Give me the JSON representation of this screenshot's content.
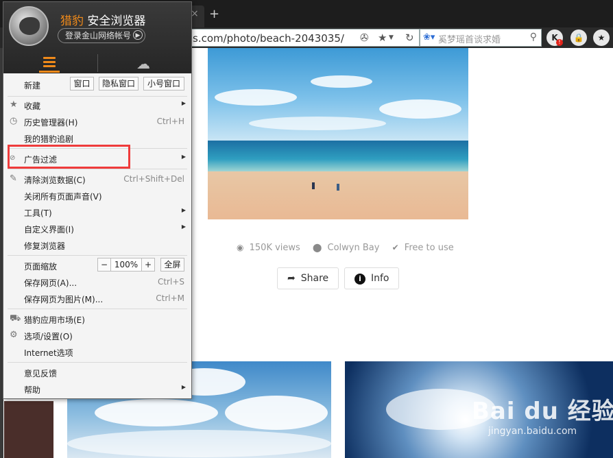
{
  "browser": {
    "tab_close": "×",
    "new_tab": "+",
    "url": "s.com/photo/beach-2043035/",
    "search_placeholder": "奚梦瑶首谈求婚",
    "account_badge": "K"
  },
  "photo": {
    "views": "150K views",
    "location": "Colwyn Bay",
    "license": "Free to use",
    "share_label": "Share",
    "info_label": "Info"
  },
  "menu": {
    "brand_accent": "猎豹",
    "brand_rest": " 安全浏览器",
    "login_label": "登录金山网络帐号",
    "new_label": "新建",
    "new_window": "窗口",
    "private_window": "隐私窗口",
    "small_window": "小号窗口",
    "favorites": "收藏",
    "history": "历史管理器(H)",
    "history_shortcut": "Ctrl+H",
    "my_shows": "我的猎豹追剧",
    "adblock": "广告过滤",
    "clear_data": "清除浏览数据(C)",
    "clear_shortcut": "Ctrl+Shift+Del",
    "mute_all": "关闭所有页面声音(V)",
    "tools": "工具(T)",
    "customize": "自定义界面(I)",
    "repair": "修复浏览器",
    "zoom_label": "页面缩放",
    "zoom_minus": "−",
    "zoom_value": "100%",
    "zoom_plus": "+",
    "fullscreen": "全屏",
    "save_page": "保存网页(A)...",
    "save_shortcut": "Ctrl+S",
    "save_image": "保存网页为图片(M)...",
    "save_image_shortcut": "Ctrl+M",
    "app_market": "猎豹应用市场(E)",
    "options": "选项/设置(O)",
    "internet_options": "Internet选项",
    "feedback": "意见反馈",
    "help": "帮助"
  },
  "watermark": {
    "main": "Bai du 经验",
    "url": "jingyan.baidu.com"
  },
  "colors": {
    "accent": "#f08a1a",
    "highlight": "#ef3b3b"
  }
}
